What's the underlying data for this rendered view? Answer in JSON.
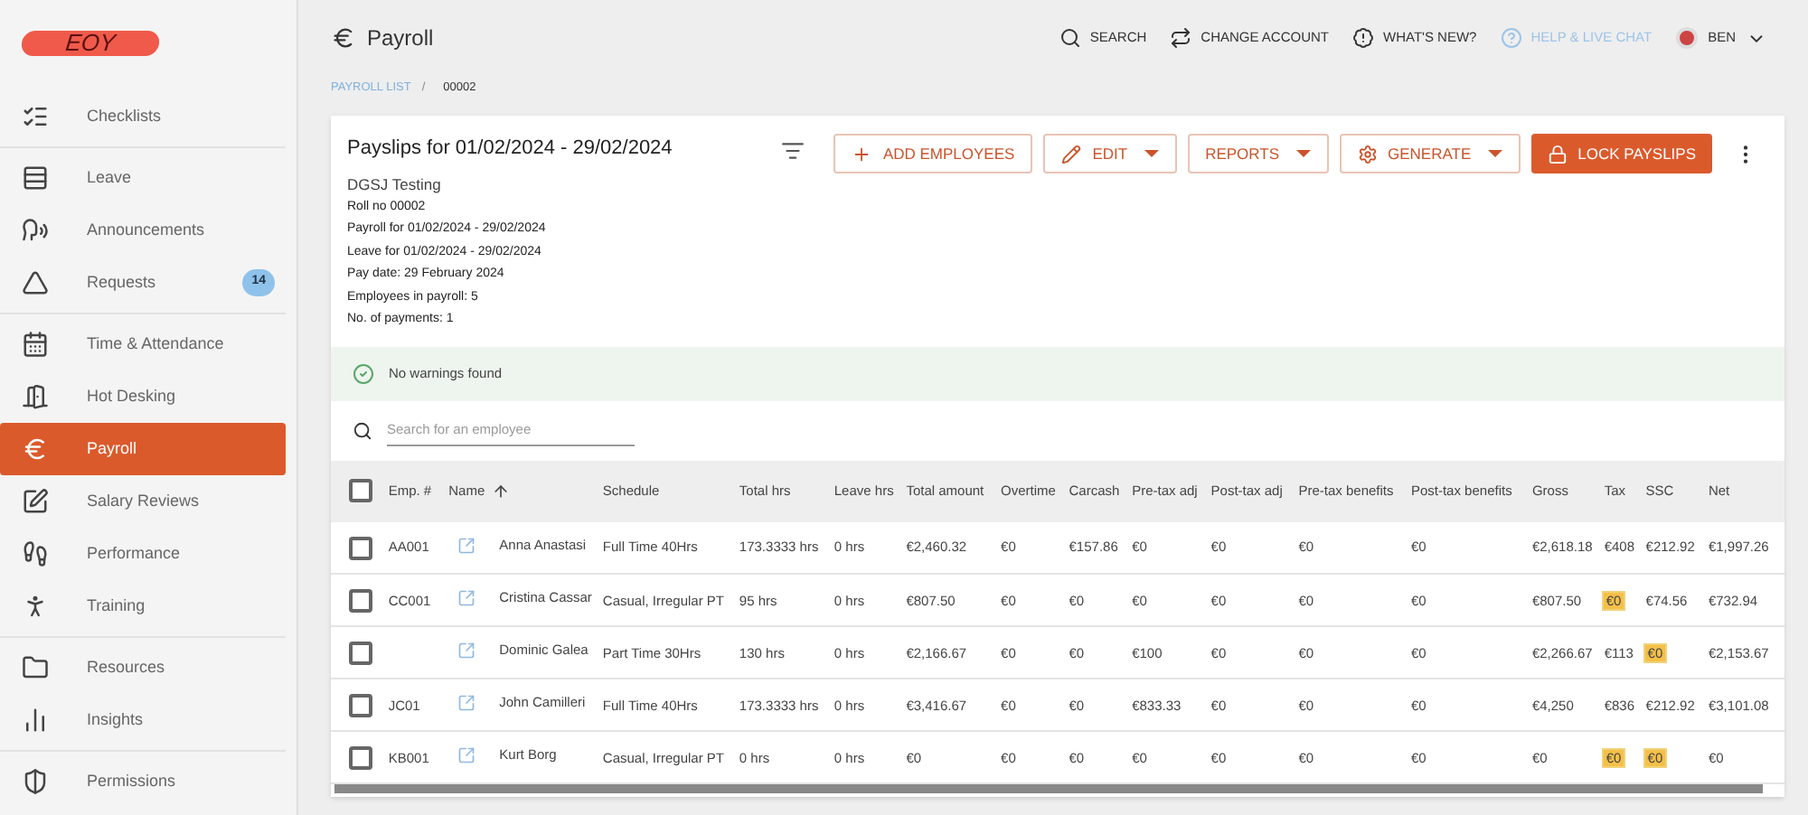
{
  "logo": {
    "text": "EOY"
  },
  "sidebar": {
    "groups": [
      [
        {
          "label": "Checklists",
          "selected": false
        }
      ],
      [
        {
          "label": "Leave",
          "selected": false
        },
        {
          "label": "Announcements",
          "selected": false
        },
        {
          "label": "Requests",
          "selected": false,
          "badge": "14"
        }
      ],
      [
        {
          "label": "Time & Attendance",
          "selected": false
        },
        {
          "label": "Hot Desking",
          "selected": false
        },
        {
          "label": "Payroll",
          "selected": true
        },
        {
          "label": "Salary Reviews",
          "selected": false
        },
        {
          "label": "Performance",
          "selected": false
        },
        {
          "label": "Training",
          "selected": false
        }
      ],
      [
        {
          "label": "Resources",
          "selected": false
        },
        {
          "label": "Insights",
          "selected": false
        }
      ],
      [
        {
          "label": "Permissions",
          "selected": false
        }
      ]
    ]
  },
  "header": {
    "title": "Payroll",
    "actions": [
      {
        "label": "SEARCH",
        "muted": false
      },
      {
        "label": "CHANGE ACCOUNT",
        "muted": false
      },
      {
        "label": "WHAT'S NEW?",
        "muted": false
      },
      {
        "label": "HELP & LIVE CHAT",
        "muted": true
      }
    ],
    "user": "BEN"
  },
  "breadcrumb": {
    "link": "PAYROLL LIST",
    "separator": "/",
    "current": "00002"
  },
  "payslips": {
    "title": "Payslips for 01/02/2024 - 29/02/2024",
    "company": "DGSJ Testing",
    "details": [
      "Roll no 00002",
      "Payroll for 01/02/2024 - 29/02/2024",
      "Leave for 01/02/2024 - 29/02/2024",
      "Pay date: 29 February 2024",
      "Employees in payroll: 5",
      "No. of payments: 1"
    ],
    "buttons": [
      {
        "label": "ADD EMPLOYEES",
        "dropdown": false,
        "primary": false
      },
      {
        "label": "EDIT",
        "dropdown": true,
        "primary": false
      },
      {
        "label": "REPORTS",
        "dropdown": true,
        "primary": false
      },
      {
        "label": "GENERATE",
        "dropdown": true,
        "primary": false
      },
      {
        "label": "LOCK PAYSLIPS",
        "dropdown": false,
        "primary": true
      }
    ]
  },
  "warning": {
    "text": "No warnings found"
  },
  "search": {
    "placeholder": "Search for an employee"
  },
  "table": {
    "select_all": {
      "checked": false
    },
    "columns": [
      "Emp. #",
      "Name",
      "Schedule",
      "Total hrs",
      "Leave hrs",
      "Total amount",
      "Overtime",
      "Carcash",
      "Pre-tax adj",
      "Post-tax adj",
      "Pre-tax benefits",
      "Post-tax benefits",
      "Gross",
      "Tax",
      "SSC",
      "Net"
    ],
    "rows": [
      {
        "checked": false,
        "cells": [
          "AA001",
          "Anna Anastasi",
          "Full Time 40Hrs",
          "173.3333 hrs",
          "0 hrs",
          "€2,460.32",
          "€0",
          "€157.86",
          "€0",
          "€0",
          "€0",
          "€0",
          "€2,618.18"
        ],
        "tax": {
          "text": "€408",
          "highlighted": false
        },
        "ssc": {
          "text": "€212.92",
          "highlighted": false
        },
        "net": "€1,997.26"
      },
      {
        "checked": false,
        "cells": [
          "CC001",
          "Cristina Cassar",
          "Casual, Irregular PT",
          "95 hrs",
          "0 hrs",
          "€807.50",
          "€0",
          "€0",
          "€0",
          "€0",
          "€0",
          "€0",
          "€807.50"
        ],
        "tax": {
          "text": "€0",
          "highlighted": true
        },
        "ssc": {
          "text": "€74.56",
          "highlighted": false
        },
        "net": "€732.94"
      },
      {
        "checked": false,
        "cells": [
          "",
          "Dominic Galea",
          "Part Time 30Hrs",
          "130 hrs",
          "0 hrs",
          "€2,166.67",
          "€0",
          "€0",
          "€100",
          "€0",
          "€0",
          "€0",
          "€2,266.67"
        ],
        "tax": {
          "text": "€113",
          "highlighted": false
        },
        "ssc": {
          "text": "€0",
          "highlighted": true
        },
        "net": "€2,153.67"
      },
      {
        "checked": false,
        "cells": [
          "JC01",
          "John Camilleri",
          "Full Time 40Hrs",
          "173.3333 hrs",
          "0 hrs",
          "€3,416.67",
          "€0",
          "€0",
          "€833.33",
          "€0",
          "€0",
          "€0",
          "€4,250"
        ],
        "tax": {
          "text": "€836",
          "highlighted": false
        },
        "ssc": {
          "text": "€212.92",
          "highlighted": false
        },
        "net": "€3,101.08"
      },
      {
        "checked": false,
        "cells": [
          "KB001",
          "Kurt Borg",
          "Casual, Irregular PT",
          "0 hrs",
          "0 hrs",
          "€0",
          "€0",
          "€0",
          "€0",
          "€0",
          "€0",
          "€0",
          "€0"
        ],
        "tax": {
          "text": "€0",
          "highlighted": true
        },
        "ssc": {
          "text": "€0",
          "highlighted": true
        },
        "net": "€0"
      }
    ]
  }
}
